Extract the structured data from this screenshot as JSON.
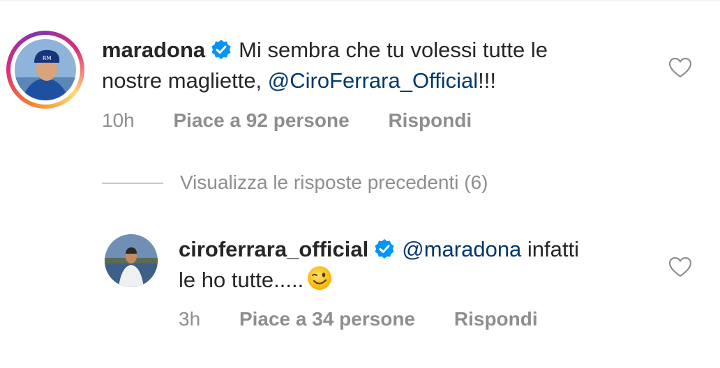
{
  "comment1": {
    "username": "maradona",
    "text_line1": "Mi sembra che tu volessi tutte le",
    "text_line2_start": "nostre magliette, ",
    "mention": "@CiroFerrara_Official",
    "text_line2_end": "!!!",
    "time": "10h",
    "likes": "Piace a 92 persone",
    "reply": "Rispondi"
  },
  "view_replies": "Visualizza le risposte precedenti (6)",
  "comment2": {
    "username": "ciroferrara_official",
    "mention": "@maradona",
    "text_line1_end": " infatti",
    "text_line2": "le ho tutte.....",
    "emoji": "winking-face",
    "time": "3h",
    "likes": "Piace a 34 persone",
    "reply": "Rispondi"
  },
  "colors": {
    "mention": "#00376b",
    "verified": "#0095f6",
    "meta": "#8e8e8e"
  }
}
